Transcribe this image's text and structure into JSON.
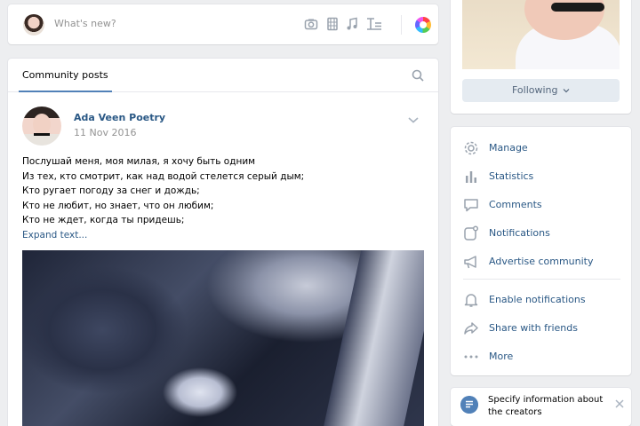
{
  "composer": {
    "placeholder": "What's new?"
  },
  "posts": {
    "tab_label": "Community posts",
    "post": {
      "author": "Ada Veen Poetry",
      "date": "11 Nov 2016",
      "lines": [
        "Послушай меня, моя милая, я хочу быть одним",
        "Из тех, кто смотрит, как над водой стелется серый дым;",
        "Кто ругает погоду за снег и дождь;",
        "Кто не любит, но знает, что он любим;",
        "Кто не ждет, когда ты придешь;"
      ],
      "expand_label": "Expand text..."
    }
  },
  "profile": {
    "follow_label": "Following"
  },
  "menu": {
    "items": [
      {
        "label": "Manage",
        "icon": "gear-icon"
      },
      {
        "label": "Statistics",
        "icon": "bar-chart-icon"
      },
      {
        "label": "Comments",
        "icon": "comment-icon"
      },
      {
        "label": "Notifications",
        "icon": "notification-icon"
      },
      {
        "label": "Advertise community",
        "icon": "megaphone-icon"
      },
      {
        "label": "Enable notifications",
        "icon": "bell-icon"
      },
      {
        "label": "Share with friends",
        "icon": "share-icon"
      },
      {
        "label": "More",
        "icon": "more-icon"
      }
    ]
  },
  "notice": {
    "text": "Specify information about the creators"
  },
  "colors": {
    "link": "#2a5885",
    "accent": "#5181b8",
    "background": "#edeef0"
  }
}
